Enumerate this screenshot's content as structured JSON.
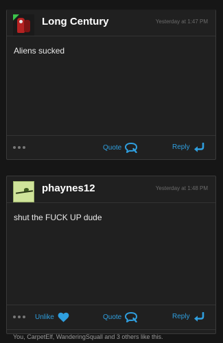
{
  "posts": [
    {
      "username": "Long Century",
      "timestamp": "Yesterday at 1:47 PM",
      "body": "Aliens sucked",
      "actions": {
        "quote": "Quote",
        "reply": "Reply"
      }
    },
    {
      "username": "phaynes12",
      "timestamp": "Yesterday at 1:48 PM",
      "body": "shut the FUCK UP dude",
      "actions": {
        "unlike": "Unlike",
        "quote": "Quote",
        "reply": "Reply"
      },
      "likes": "You, CarpetElf, WanderingSquall and 3 others like this."
    }
  ],
  "colors": {
    "accent": "#2f9fdf",
    "background": "#161616",
    "card": "#202020",
    "username": "#ffffff",
    "muted": "#6b6b6b"
  },
  "icons": [
    "more-dots-icon",
    "quote-bubble-icon",
    "reply-arrow-icon",
    "heart-icon"
  ]
}
